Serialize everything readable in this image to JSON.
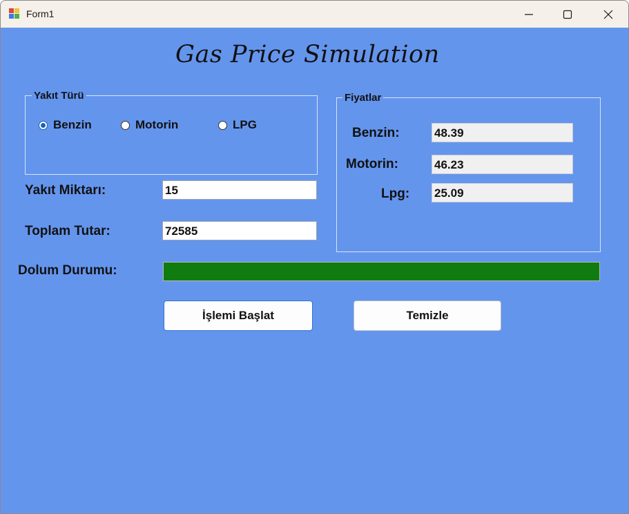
{
  "window": {
    "title": "Form1"
  },
  "heading": "Gas Price Simulation",
  "fuel_type": {
    "legend": "Yakıt Türü",
    "options": [
      {
        "label": "Benzin",
        "checked": true
      },
      {
        "label": "Motorin",
        "checked": false
      },
      {
        "label": "LPG",
        "checked": false
      }
    ]
  },
  "form": {
    "amount_label": "Yakıt Miktarı:",
    "amount_value": "15",
    "total_label": "Toplam Tutar:",
    "total_value": "72585",
    "fill_label": "Dolum Durumu:",
    "fill_progress_percent": 100
  },
  "prices": {
    "legend": "Fiyatlar",
    "benzin_label": "Benzin:",
    "benzin_value": "48.39",
    "motorin_label": "Motorin:",
    "motorin_value": "46.23",
    "lpg_label": "Lpg:",
    "lpg_value": "25.09"
  },
  "buttons": {
    "start_label": "İşlemi Başlat",
    "clear_label": "Temizle"
  },
  "colors": {
    "form_background": "#6495ed",
    "progress_fill": "#107c10",
    "titlebar": "#f6f0ea"
  },
  "icons": {
    "app": "app-form-icon",
    "minimize": "minimize-icon",
    "maximize": "maximize-icon",
    "close": "close-icon"
  }
}
